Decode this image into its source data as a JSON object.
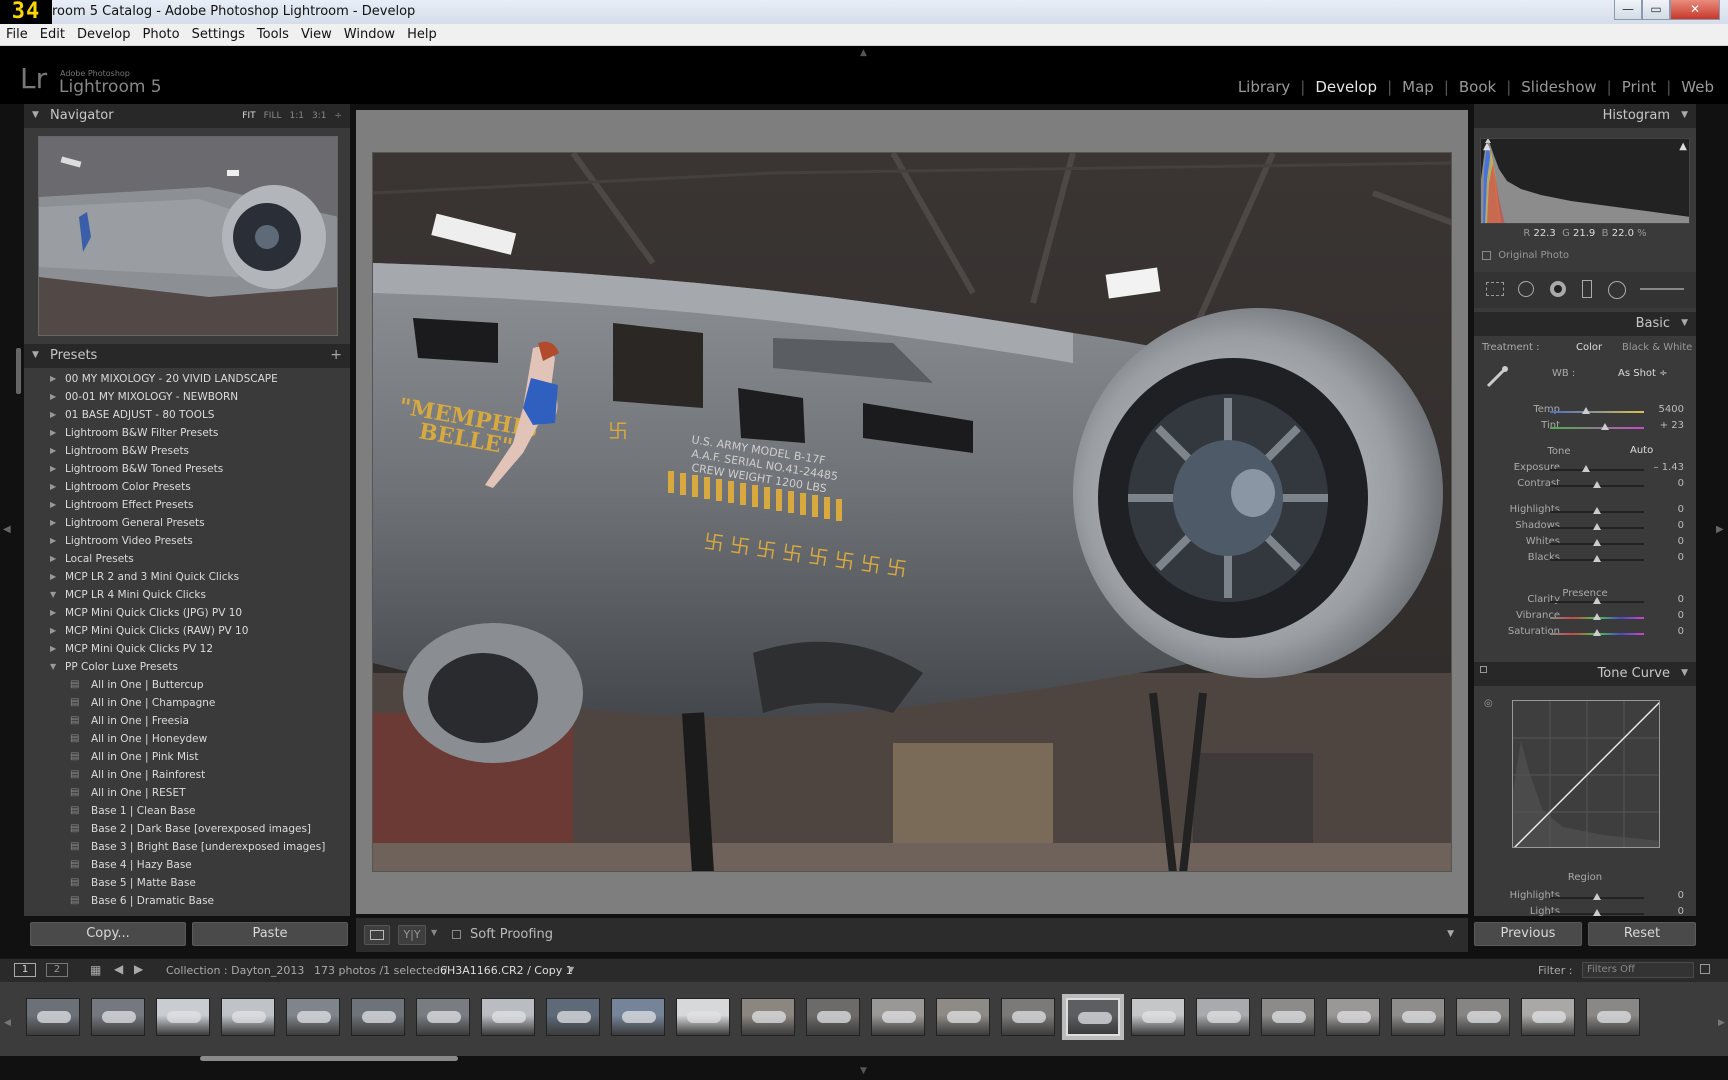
{
  "window": {
    "badge": "34",
    "title": "room 5 Catalog - Adobe Photoshop Lightroom - Develop",
    "minimize": "—",
    "maximize": "▭",
    "close": "✕"
  },
  "menu": [
    "File",
    "Edit",
    "Develop",
    "Photo",
    "Settings",
    "Tools",
    "View",
    "Window",
    "Help"
  ],
  "identity": {
    "logo": "Lr",
    "brand": "Adobe Photoshop",
    "product": "Lightroom 5"
  },
  "modules": [
    "Library",
    "Develop",
    "Map",
    "Book",
    "Slideshow",
    "Print",
    "Web"
  ],
  "active_module": "Develop",
  "navigator": {
    "title": "Navigator",
    "options": [
      "FIT",
      "FILL",
      "1:1",
      "3:1"
    ]
  },
  "presets": {
    "title": "Presets",
    "add": "+",
    "items": [
      {
        "label": "00 MY MIXOLOGY - 20 VIVID LANDSCAPE",
        "type": "folder",
        "open": false
      },
      {
        "label": "00-01 MY MIXOLOGY - NEWBORN",
        "type": "folder",
        "open": false
      },
      {
        "label": "01 BASE ADJUST - 80 TOOLS",
        "type": "folder",
        "open": false
      },
      {
        "label": "Lightroom B&W Filter Presets",
        "type": "folder",
        "open": false
      },
      {
        "label": "Lightroom B&W Presets",
        "type": "folder",
        "open": false
      },
      {
        "label": "Lightroom B&W Toned Presets",
        "type": "folder",
        "open": false
      },
      {
        "label": "Lightroom Color Presets",
        "type": "folder",
        "open": false
      },
      {
        "label": "Lightroom Effect Presets",
        "type": "folder",
        "open": false
      },
      {
        "label": "Lightroom General Presets",
        "type": "folder",
        "open": false
      },
      {
        "label": "Lightroom Video Presets",
        "type": "folder",
        "open": false
      },
      {
        "label": "Local Presets",
        "type": "folder",
        "open": false
      },
      {
        "label": "MCP LR 2 and 3 Mini Quick Clicks",
        "type": "folder",
        "open": false
      },
      {
        "label": "MCP LR 4 Mini Quick Clicks",
        "type": "folder",
        "open": true
      },
      {
        "label": "MCP Mini Quick Clicks (JPG) PV 10",
        "type": "folder",
        "open": false
      },
      {
        "label": "MCP Mini Quick Clicks (RAW) PV 10",
        "type": "folder",
        "open": false
      },
      {
        "label": "MCP Mini Quick Clicks PV 12",
        "type": "folder",
        "open": false
      },
      {
        "label": "PP Color Luxe Presets",
        "type": "folder",
        "open": true
      },
      {
        "label": "All in One | Buttercup",
        "type": "preset"
      },
      {
        "label": "All in One | Champagne",
        "type": "preset"
      },
      {
        "label": "All in One | Freesia",
        "type": "preset"
      },
      {
        "label": "All in One | Honeydew",
        "type": "preset"
      },
      {
        "label": "All in One | Pink Mist",
        "type": "preset"
      },
      {
        "label": "All in One | Rainforest",
        "type": "preset"
      },
      {
        "label": "All in One | RESET",
        "type": "preset"
      },
      {
        "label": "Base 1 | Clean Base",
        "type": "preset"
      },
      {
        "label": "Base 2 | Dark Base [overexposed images]",
        "type": "preset"
      },
      {
        "label": "Base 3 | Bright Base [underexposed images]",
        "type": "preset"
      },
      {
        "label": "Base 4 | Hazy Base",
        "type": "preset"
      },
      {
        "label": "Base 5 | Matte Base",
        "type": "preset"
      },
      {
        "label": "Base 6 | Dramatic Base",
        "type": "preset"
      }
    ]
  },
  "left_buttons": {
    "copy": "Copy...",
    "paste": "Paste"
  },
  "toolbar": {
    "soft_proofing": "Soft Proofing",
    "yy": "Y|Y"
  },
  "histogram": {
    "title": "Histogram",
    "r_label": "R",
    "r": "22.3",
    "g_label": "G",
    "g": "21.9",
    "b_label": "B",
    "b": "22.0",
    "pct": "%",
    "original_photo": "Original Photo"
  },
  "basic": {
    "title": "Basic",
    "treatment_label": "Treatment :",
    "color": "Color",
    "bw": "Black & White",
    "wb_label": "WB :",
    "wb_value": "As Shot ÷",
    "tone_label": "Tone",
    "auto": "Auto",
    "presence_label": "Presence",
    "sliders": [
      {
        "label": "Temp",
        "value": "5400",
        "pos": 0.38
      },
      {
        "label": "Tint",
        "value": "+ 23",
        "pos": 0.58
      },
      {
        "label": "Exposure",
        "value": "– 1.43",
        "pos": 0.38
      },
      {
        "label": "Contrast",
        "value": "0",
        "pos": 0.5
      },
      {
        "label": "Highlights",
        "value": "0",
        "pos": 0.5
      },
      {
        "label": "Shadows",
        "value": "0",
        "pos": 0.5
      },
      {
        "label": "Whites",
        "value": "0",
        "pos": 0.5
      },
      {
        "label": "Blacks",
        "value": "0",
        "pos": 0.5
      },
      {
        "label": "Clarity",
        "value": "0",
        "pos": 0.5
      },
      {
        "label": "Vibrance",
        "value": "0",
        "pos": 0.5
      },
      {
        "label": "Saturation",
        "value": "0",
        "pos": 0.5
      }
    ]
  },
  "tone_curve": {
    "title": "Tone Curve",
    "region_label": "Region",
    "sliders": [
      {
        "label": "Highlights",
        "value": "0",
        "pos": 0.5
      },
      {
        "label": "Lights",
        "value": "0",
        "pos": 0.5
      }
    ]
  },
  "right_buttons": {
    "previous": "Previous",
    "reset": "Reset"
  },
  "filmstrip_bar": {
    "page1": "1",
    "page2": "2",
    "collection": "Collection : Dayton_2013",
    "count": "173 photos /1 selected /",
    "file": "6H3A1166.CR2 / Copy 1",
    "filter_label": "Filter :",
    "filter_value": "Filters Off"
  },
  "colors": {
    "accent": "#e6e6e6",
    "panel": "#3a3a3a",
    "header": "#282828",
    "background": "#111111"
  }
}
